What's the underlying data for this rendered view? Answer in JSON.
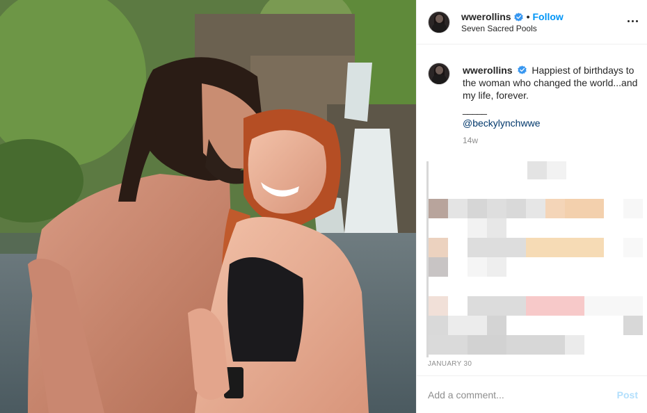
{
  "post": {
    "username": "wwerollins",
    "verified": true,
    "follow_label": "Follow",
    "separator_dot": "•",
    "location": "Seven Sacred Pools"
  },
  "caption": {
    "username": "wwerollins",
    "text": "Happiest of birthdays to the woman who changed the world...and my life, forever.",
    "separator": "_____",
    "mention": "@beckylynchwwe",
    "time_ago": "14w"
  },
  "date": "JANUARY 30",
  "comment_box": {
    "placeholder": "Add a comment...",
    "post_label": "Post"
  },
  "icons": {
    "more": "more-options-icon",
    "verified": "verified-badge-icon"
  },
  "colors": {
    "link_blue": "#0095f6",
    "mention_blue": "#00376b",
    "muted": "#8e8e8e",
    "post_disabled": "#b2dffc"
  }
}
